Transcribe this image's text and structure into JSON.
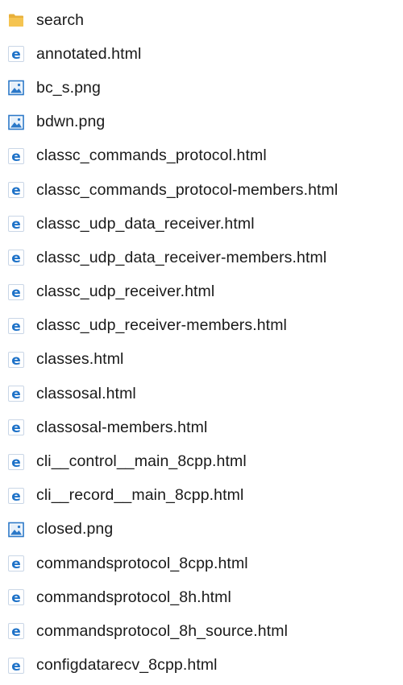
{
  "files": [
    {
      "name": "search",
      "type": "folder"
    },
    {
      "name": "annotated.html",
      "type": "html"
    },
    {
      "name": "bc_s.png",
      "type": "image"
    },
    {
      "name": "bdwn.png",
      "type": "image"
    },
    {
      "name": "classc_commands_protocol.html",
      "type": "html"
    },
    {
      "name": "classc_commands_protocol-members.html",
      "type": "html"
    },
    {
      "name": "classc_udp_data_receiver.html",
      "type": "html"
    },
    {
      "name": "classc_udp_data_receiver-members.html",
      "type": "html"
    },
    {
      "name": "classc_udp_receiver.html",
      "type": "html"
    },
    {
      "name": "classc_udp_receiver-members.html",
      "type": "html"
    },
    {
      "name": "classes.html",
      "type": "html"
    },
    {
      "name": "classosal.html",
      "type": "html"
    },
    {
      "name": "classosal-members.html",
      "type": "html"
    },
    {
      "name": "cli__control__main_8cpp.html",
      "type": "html"
    },
    {
      "name": "cli__record__main_8cpp.html",
      "type": "html"
    },
    {
      "name": "closed.png",
      "type": "image"
    },
    {
      "name": "commandsprotocol_8cpp.html",
      "type": "html"
    },
    {
      "name": "commandsprotocol_8h.html",
      "type": "html"
    },
    {
      "name": "commandsprotocol_8h_source.html",
      "type": "html"
    },
    {
      "name": "configdatarecv_8cpp.html",
      "type": "html"
    }
  ],
  "icons": {
    "folder": "folder-icon",
    "html": "edge-html-icon",
    "image": "image-file-icon"
  },
  "colors": {
    "edge_blue": "#1e72c8",
    "folder_yellow": "#f5c451",
    "image_blue": "#2b78c8",
    "text": "#1a1a1a"
  }
}
